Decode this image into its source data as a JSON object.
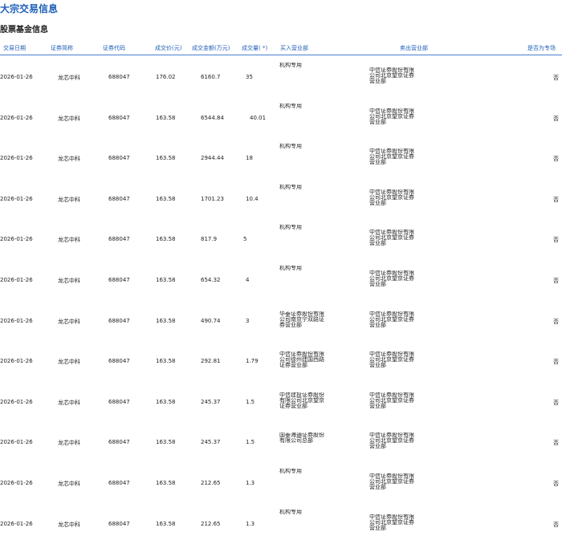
{
  "page": {
    "title": "大宗交易信息",
    "section": "股票基金信息"
  },
  "table": {
    "headers": [
      "交易日期",
      "证券简称",
      "证券代码",
      "成交价(元)",
      "成交金额(万元)",
      "成交量( *)",
      "买入营业部",
      "卖出营业部",
      "是否为专场"
    ],
    "rows": [
      {
        "date": "2026-01-26",
        "name": "龙芯中科",
        "code": "688047",
        "price": "176.02",
        "amount": "6160.7",
        "volume": "35",
        "buyer": "机构专用",
        "seller": "中信证券股份有限公司北京望京证券营业部",
        "special": "否"
      },
      {
        "date": "2026-01-26",
        "name": "龙芯中科",
        "code": "688047",
        "price": "163.58",
        "amount": "6544.84",
        "volume": "40.01",
        "buyer": "机构专用",
        "seller": "中信证券股份有限公司北京望京证券营业部",
        "special": "否"
      },
      {
        "date": "2026-01-26",
        "name": "龙芯中科",
        "code": "688047",
        "price": "163.58",
        "amount": "2944.44",
        "volume": "18",
        "buyer": "机构专用",
        "seller": "中信证券股份有限公司北京望京证券营业部",
        "special": "否"
      },
      {
        "date": "2026-01-26",
        "name": "龙芯中科",
        "code": "688047",
        "price": "163.58",
        "amount": "1701.23",
        "volume": "10.4",
        "buyer": "机构专用",
        "seller": "中信证券股份有限公司北京望京证券营业部",
        "special": "否"
      },
      {
        "date": "2026-01-26",
        "name": "龙芯中科",
        "code": "688047",
        "price": "163.58",
        "amount": "817.9",
        "volume": "5",
        "buyer": "机构专用",
        "seller": "中信证券股份有限公司北京望京证券营业部",
        "special": "否"
      },
      {
        "date": "2026-01-26",
        "name": "龙芯中科",
        "code": "688047",
        "price": "163.58",
        "amount": "654.32",
        "volume": "4",
        "buyer": "机构专用",
        "seller": "中信证券股份有限公司北京望京证券营业部",
        "special": "否"
      },
      {
        "date": "2026-01-26",
        "name": "龙芯中科",
        "code": "688047",
        "price": "163.58",
        "amount": "490.74",
        "volume": "3",
        "buyer": "华泰证券股份有限公司南京宁双路证券营业部",
        "seller": "中信证券股份有限公司北京望京证券营业部",
        "special": "否"
      },
      {
        "date": "2026-01-26",
        "name": "龙芯中科",
        "code": "688047",
        "price": "163.58",
        "amount": "292.81",
        "volume": "1.79",
        "buyer": "中信证券股份有限公司徐州建国西路证券营业部",
        "seller": "中信证券股份有限公司北京望京证券营业部",
        "special": "否"
      },
      {
        "date": "2026-01-26",
        "name": "龙芯中科",
        "code": "688047",
        "price": "163.58",
        "amount": "245.37",
        "volume": "1.5",
        "buyer": "中信建投证券股份有限公司北京望京证券营业部",
        "seller": "中信证券股份有限公司北京望京证券营业部",
        "special": "否"
      },
      {
        "date": "2026-01-26",
        "name": "龙芯中科",
        "code": "688047",
        "price": "163.58",
        "amount": "245.37",
        "volume": "1.5",
        "buyer": "国泰海通证券股份有限公司总部",
        "seller": "中信证券股份有限公司北京望京证券营业部",
        "special": "否"
      },
      {
        "date": "2026-01-26",
        "name": "龙芯中科",
        "code": "688047",
        "price": "163.58",
        "amount": "212.65",
        "volume": "1.3",
        "buyer": "机构专用",
        "seller": "中信证券股份有限公司北京望京证券营业部",
        "special": "否"
      },
      {
        "date": "2026-01-26",
        "name": "龙芯中科",
        "code": "688047",
        "price": "163.58",
        "amount": "212.65",
        "volume": "1.3",
        "buyer": "机构专用",
        "seller": "中信证券股份有限公司北京望京证券营业部",
        "special": "否"
      }
    ]
  }
}
